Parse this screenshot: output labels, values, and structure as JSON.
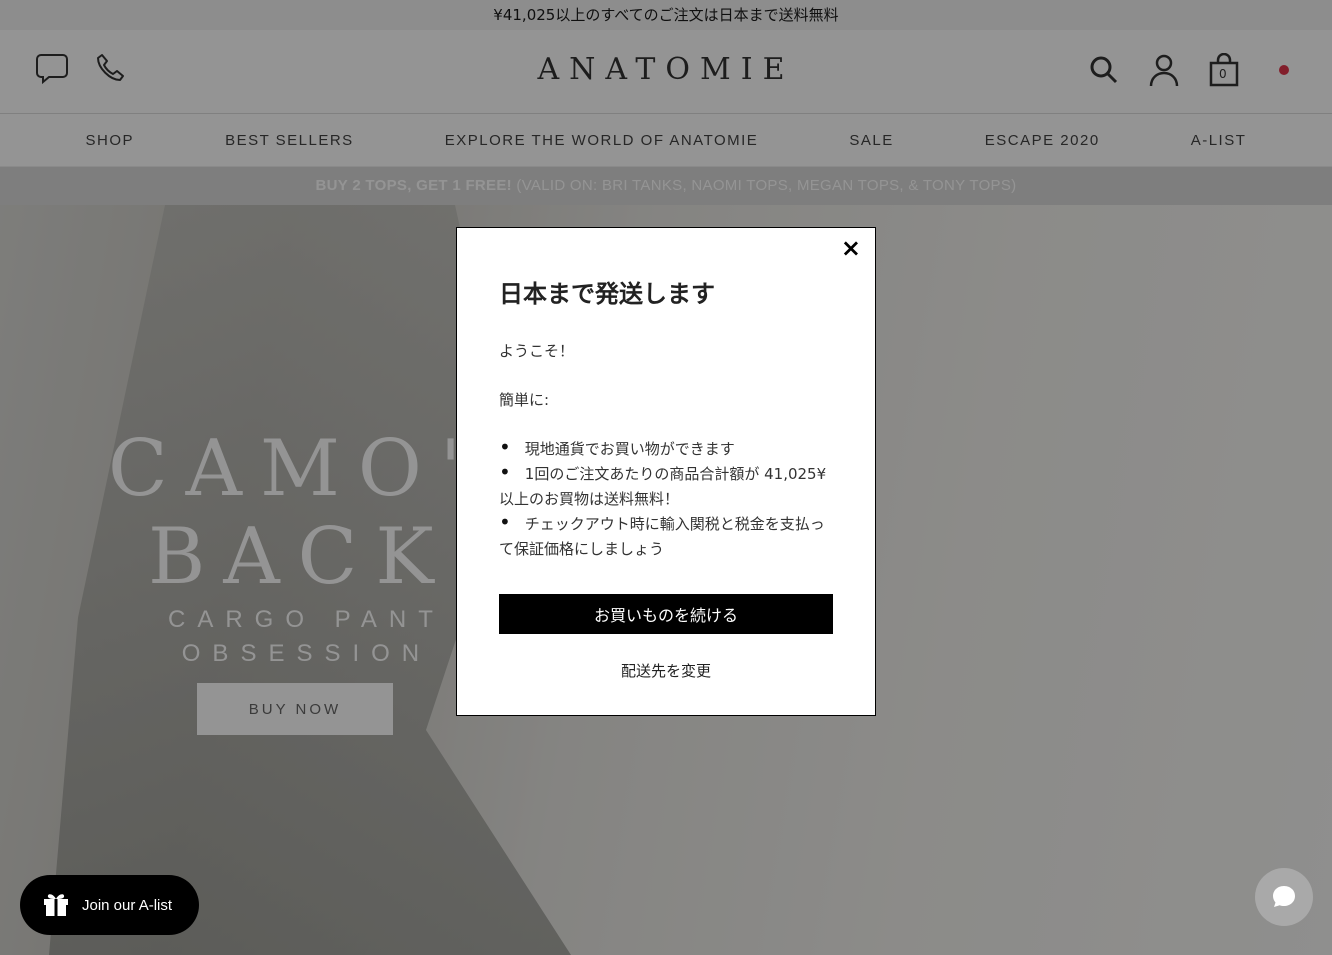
{
  "topbar": {
    "text": "¥41,025以上のすべてのご注文は日本まで送料無料"
  },
  "header": {
    "logo": "ANATOMIE",
    "cart_count": "0"
  },
  "nav": {
    "items": [
      {
        "label": "SHOP"
      },
      {
        "label": "BEST SELLERS"
      },
      {
        "label": "EXPLORE THE WORLD OF ANATOMIE"
      },
      {
        "label": "SALE"
      },
      {
        "label": "ESCAPE 2020"
      },
      {
        "label": "A-LIST"
      }
    ]
  },
  "promo": {
    "bold": "BUY 2 TOPS, GET 1 FREE!",
    "rest": " (VALID ON: BRI TANKS, NAOMI TOPS, MEGAN TOPS, & TONY TOPS)"
  },
  "hero": {
    "headline_line1": "CAMO'S",
    "headline_line2": "BACK!",
    "sub_line1": "CARGO PANT",
    "sub_line2": "OBSESSION",
    "button": "BUY NOW"
  },
  "modal": {
    "close": "×",
    "title": "日本まで発送します",
    "greeting": "ようこそ！",
    "simply": "簡単に:",
    "bullets": [
      "現地通貨でお買い物ができます",
      "1回のご注文あたりの商品合計額が 41,025¥ 以上のお買物は送料無料！",
      "チェックアウト時に輸入関税と税金を支払って保証価格にしましょう"
    ],
    "cta": "お買いものを続ける",
    "change": "配送先を変更"
  },
  "alist": {
    "label": "Join our A-list"
  },
  "colors": {
    "overlay": "#000000",
    "cta_bg": "#000000",
    "promo_bg": "#d9d9d9"
  }
}
